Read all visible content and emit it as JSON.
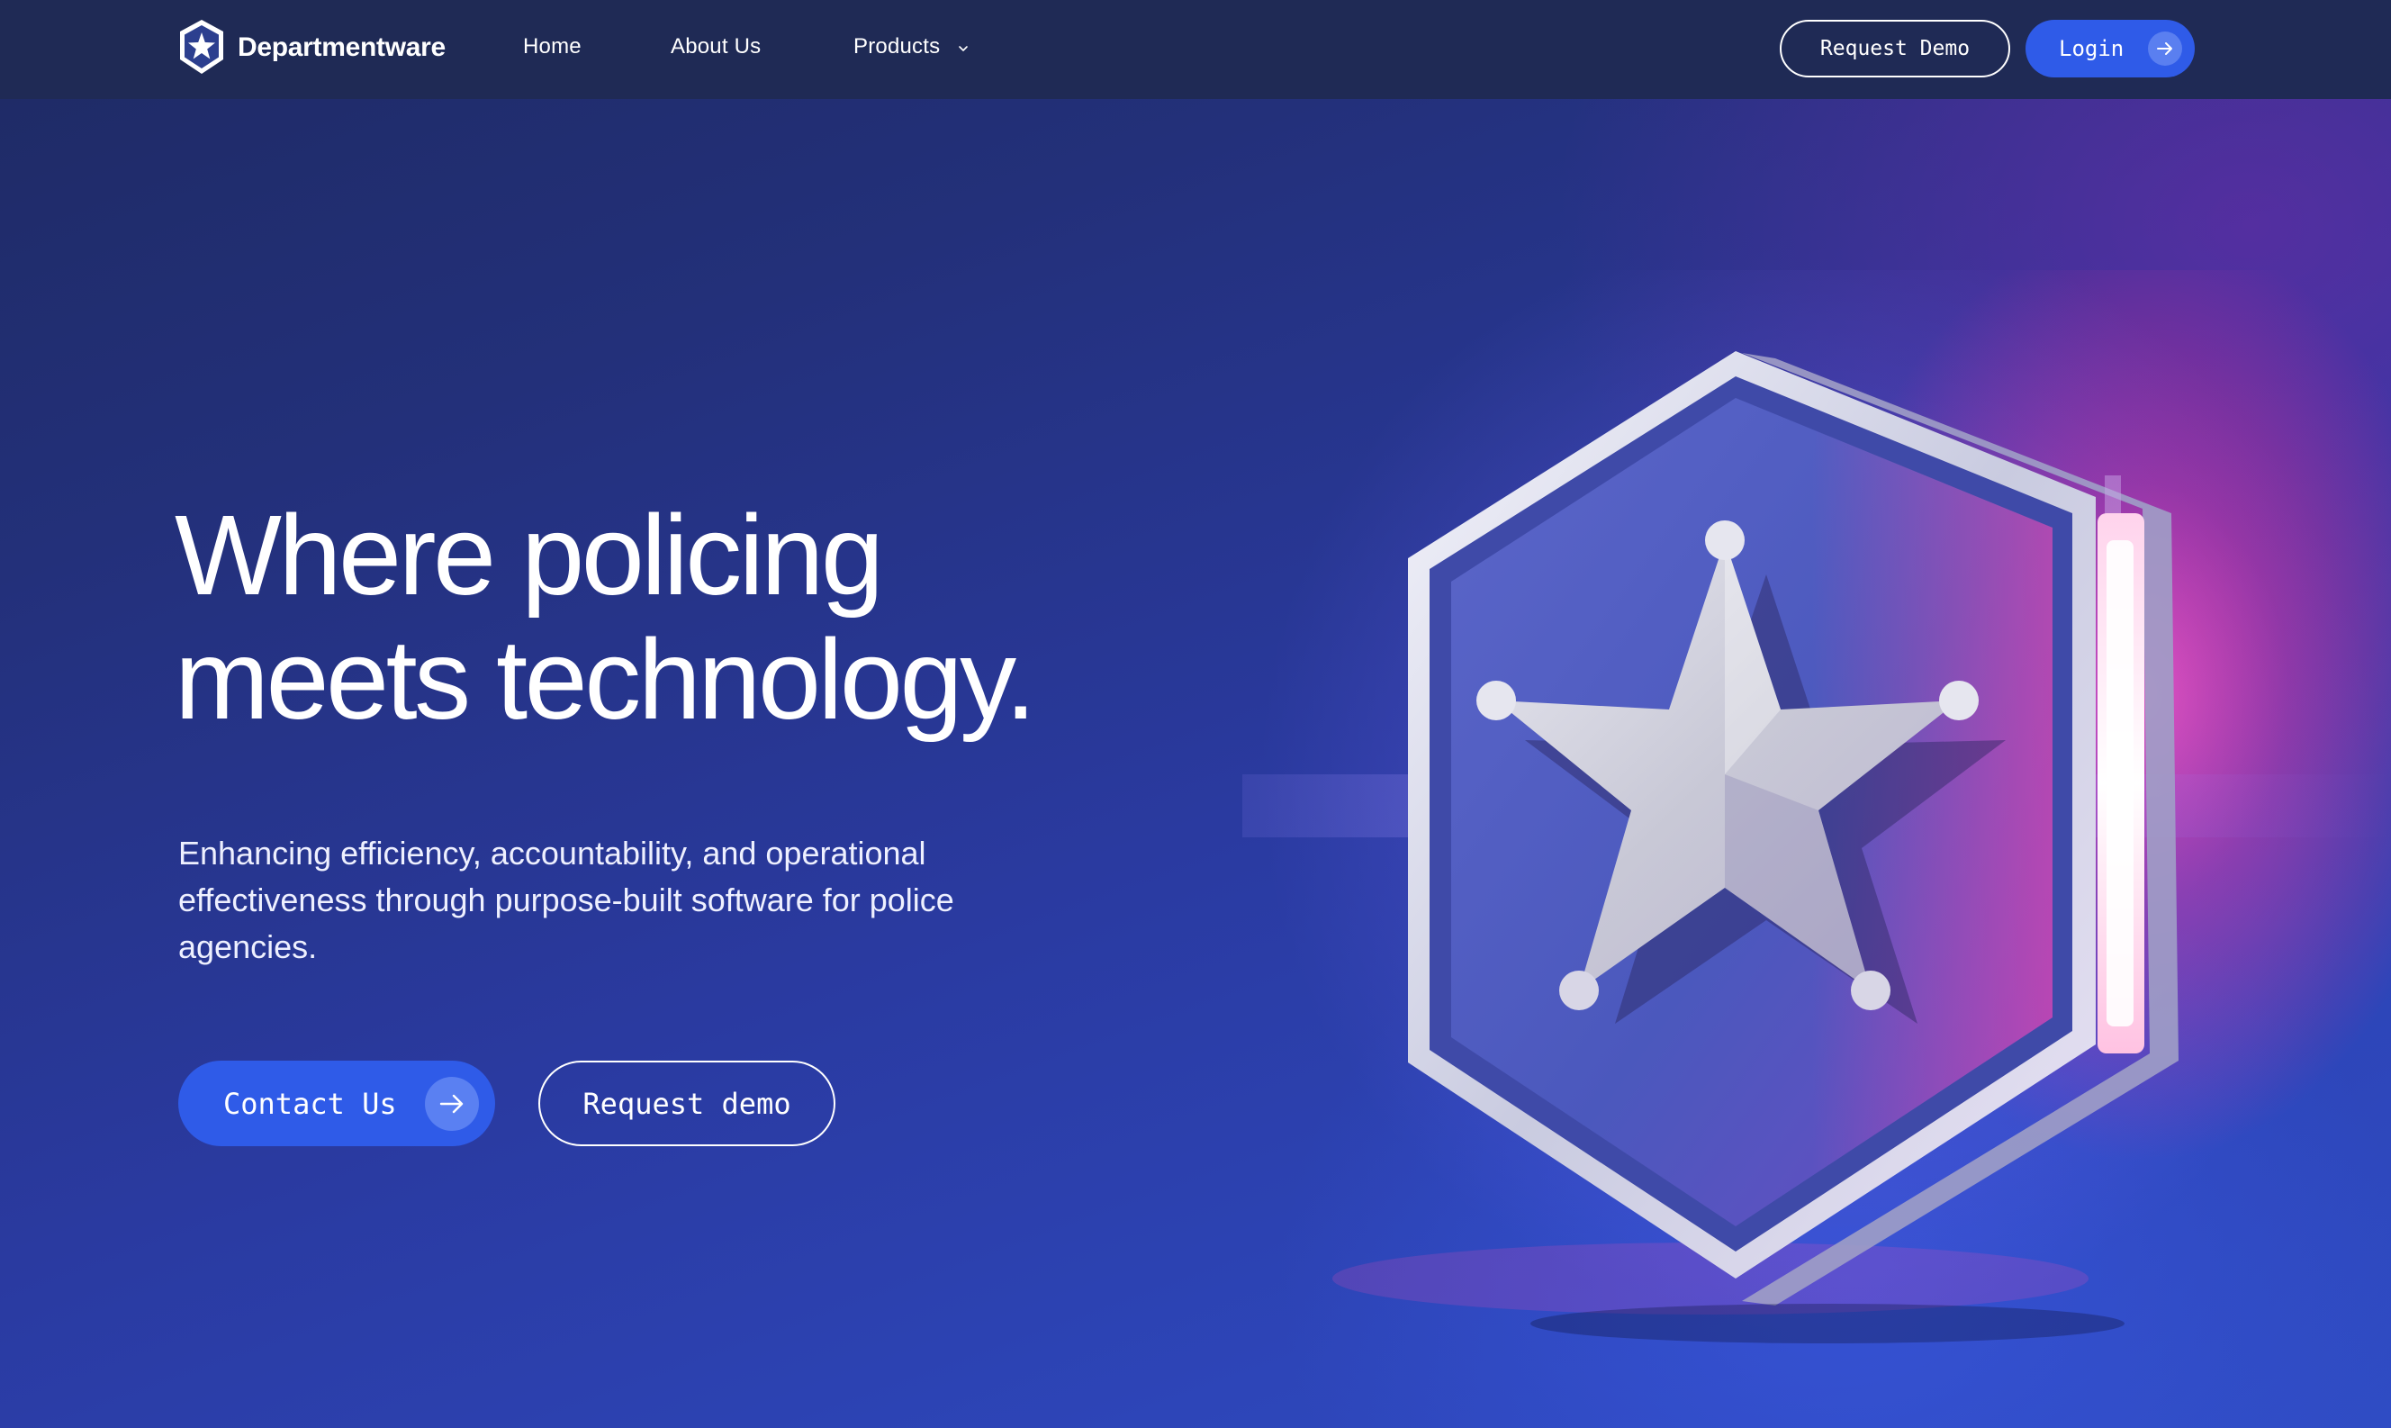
{
  "brand": {
    "name": "Departmentware",
    "logo_icon": "shield-star-icon"
  },
  "nav": {
    "home": "Home",
    "about": "About Us",
    "products": "Products",
    "products_icon": "chevron-down-icon",
    "request_demo": "Request Demo",
    "login": "Login",
    "login_icon": "arrow-right-icon"
  },
  "hero": {
    "title_line1": "Where policing",
    "title_line2": "meets technology.",
    "subtitle_line1": "Enhancing efficiency, accountability, and operational",
    "subtitle_line2": "effectiveness through purpose-built software for police",
    "subtitle_line3": "agencies.",
    "contact_label": "Contact Us",
    "contact_icon": "arrow-right-icon",
    "demo_label": "Request demo",
    "illustration": "police-badge-star-image"
  },
  "colors": {
    "navbar_bg": "#1f2a55",
    "primary_button": "#2f5be8",
    "hero_bg": "#2a3596",
    "glow": "#ff3fa8"
  }
}
